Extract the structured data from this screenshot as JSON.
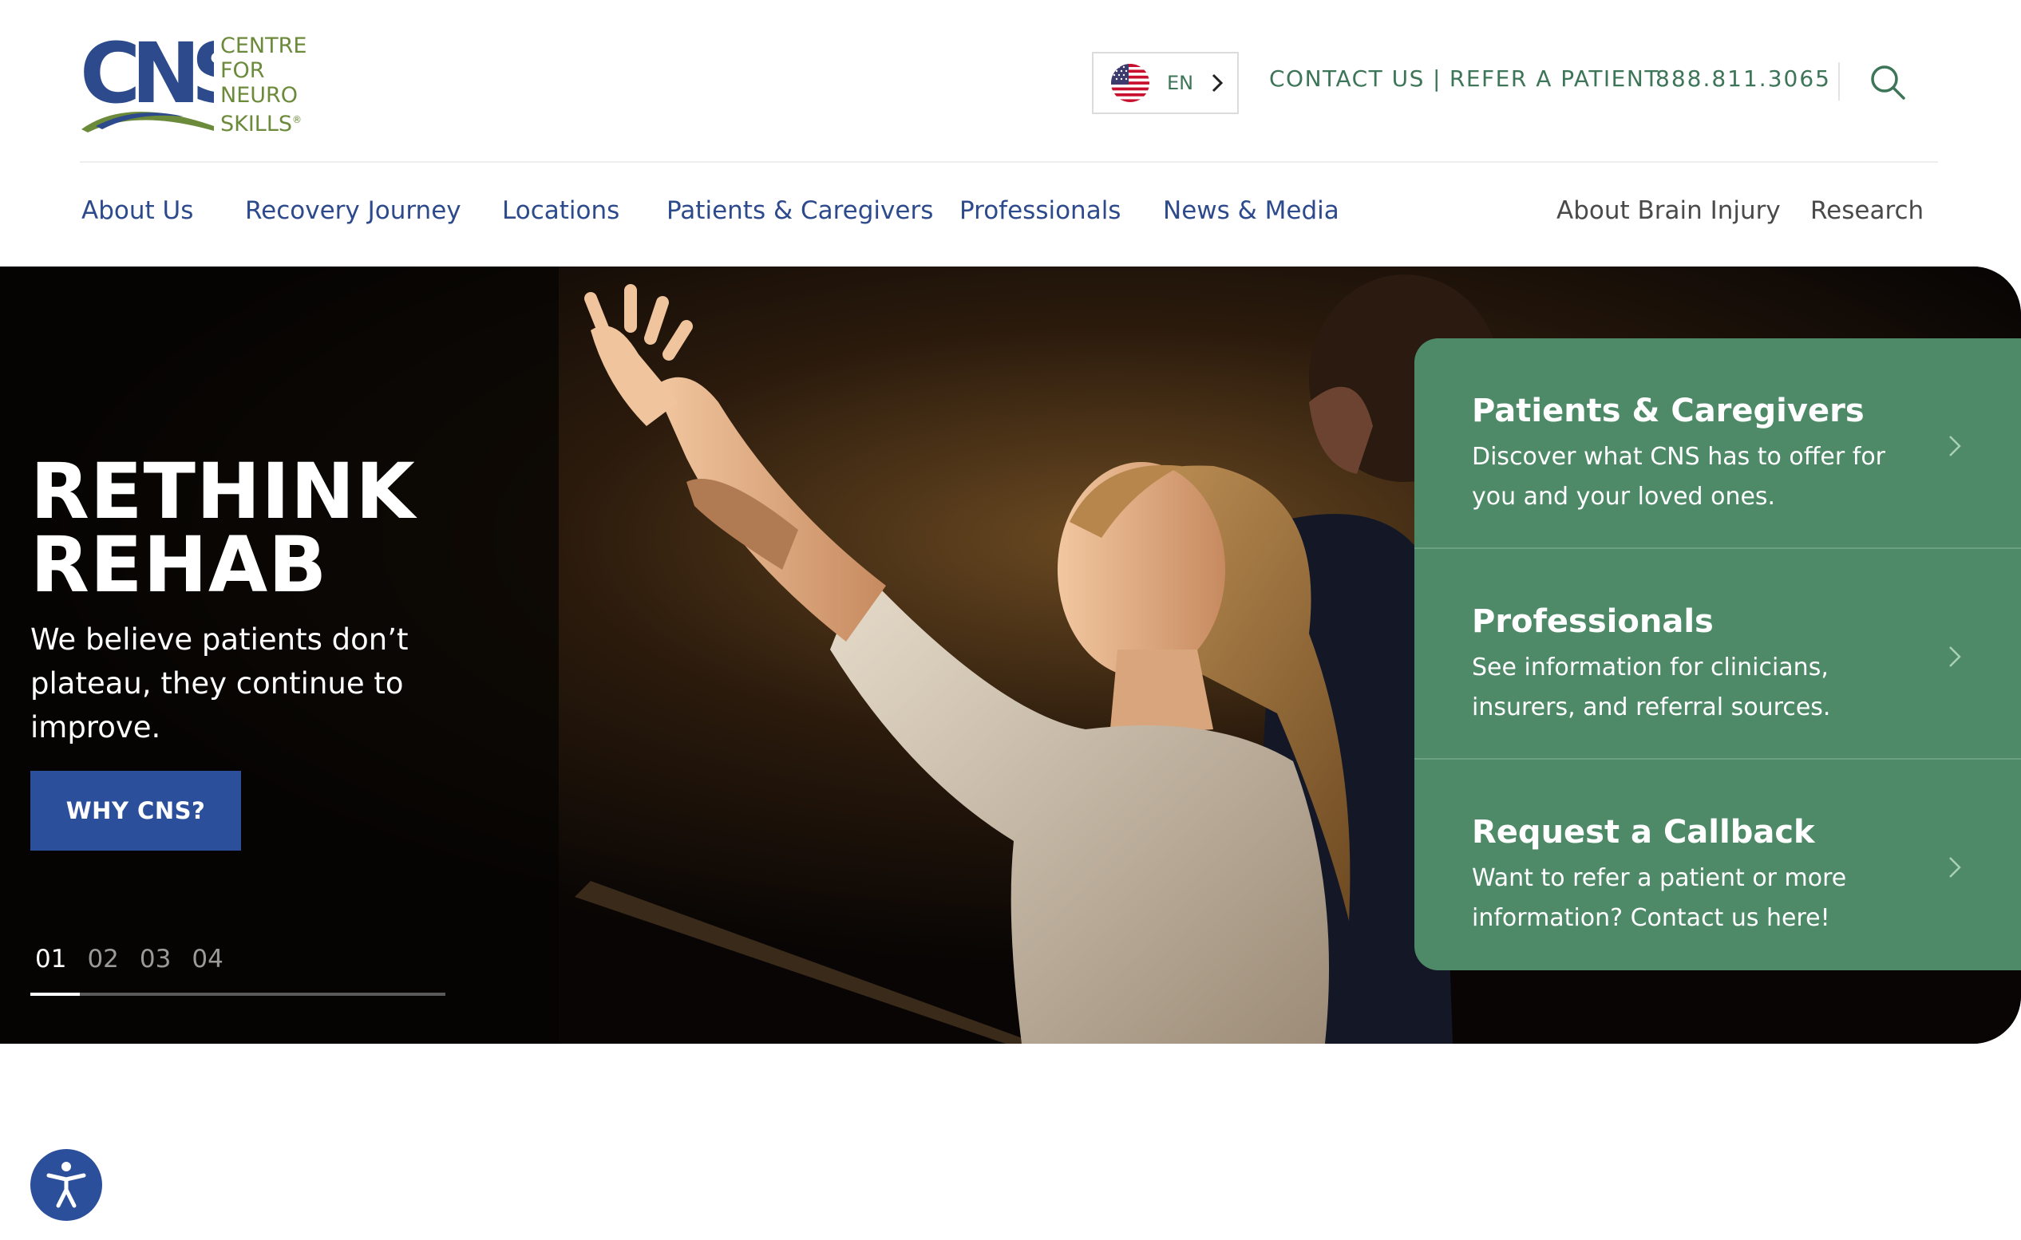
{
  "brand": {
    "logo_mark": "CNS",
    "logo_lines": [
      "CENTRE",
      "FOR",
      "NEURO",
      "SKILLS"
    ],
    "reg_mark": "®",
    "colors": {
      "blue": "#2c4a8c",
      "green": "#3d7558",
      "card_green": "#4e8a68",
      "olive": "#6b8a3a"
    }
  },
  "header": {
    "language": {
      "code": "EN",
      "icon": "us-flag-icon"
    },
    "contact_label": "CONTACT US",
    "separator": "|",
    "refer_label": "REFER A PATIENT",
    "phone": "888.811.3065",
    "search_icon": "search-icon"
  },
  "nav": {
    "primary": [
      "About Us",
      "Recovery Journey",
      "Locations",
      "Patients & Caregivers",
      "Professionals",
      "News & Media"
    ],
    "secondary": [
      "About Brain Injury",
      "Research"
    ]
  },
  "hero": {
    "title_line1": "RETHINK",
    "title_line2": "REHAB",
    "subtitle": "We believe patients don’t plateau, they continue to improve.",
    "cta_label": "WHY CNS?",
    "slides": [
      "01",
      "02",
      "03",
      "04"
    ],
    "active_slide": 0,
    "progress_fraction": 0.12
  },
  "cards": [
    {
      "title": "Patients & Caregivers",
      "description": "Discover what CNS has to offer for you and your loved ones."
    },
    {
      "title": "Professionals",
      "description": "See information for clinicians, insurers, and referral sources."
    },
    {
      "title": "Request a Callback",
      "description": "Want to refer a patient or more information? Contact us here!"
    }
  ],
  "accessibility": {
    "icon": "accessibility-icon"
  }
}
